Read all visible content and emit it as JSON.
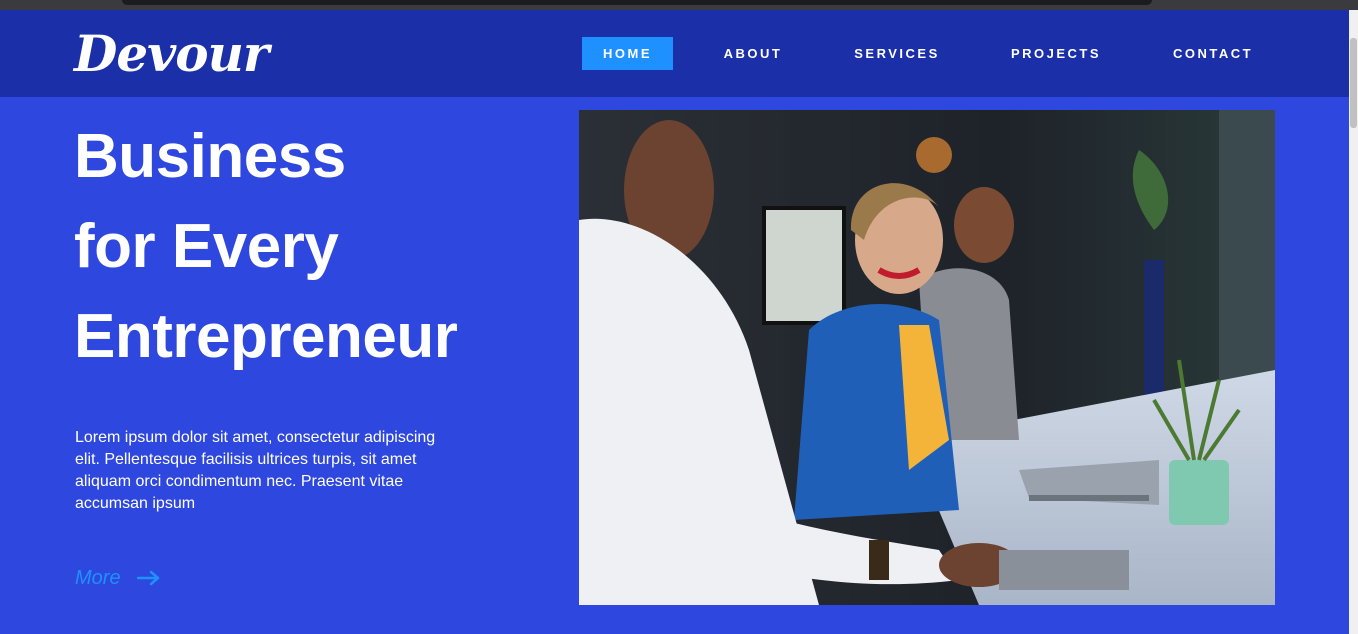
{
  "brand": {
    "logo_text": "Devour"
  },
  "nav": {
    "items": [
      {
        "label": "HOME",
        "active": true
      },
      {
        "label": "ABOUT",
        "active": false
      },
      {
        "label": "SERVICES",
        "active": false
      },
      {
        "label": "PROJECTS",
        "active": false
      },
      {
        "label": "CONTACT",
        "active": false
      }
    ]
  },
  "hero": {
    "title_lines": [
      "Business",
      "for Every",
      "Entrepreneur"
    ],
    "text": "Lorem ipsum dolor sit amet, consectetur adipiscing elit. Pellentesque facilisis ultrices turpis, sit amet aliquam orci condimentum nec. Praesent vitae accumsan ipsum",
    "more_label": "More",
    "more_icon": "arrow-right-icon",
    "image_icon": "office-team-photo"
  },
  "colors": {
    "page_bg": "#2e47de",
    "navbar_bg": "#1b2fa8",
    "accent": "#1e90ff",
    "text": "#ffffff"
  }
}
